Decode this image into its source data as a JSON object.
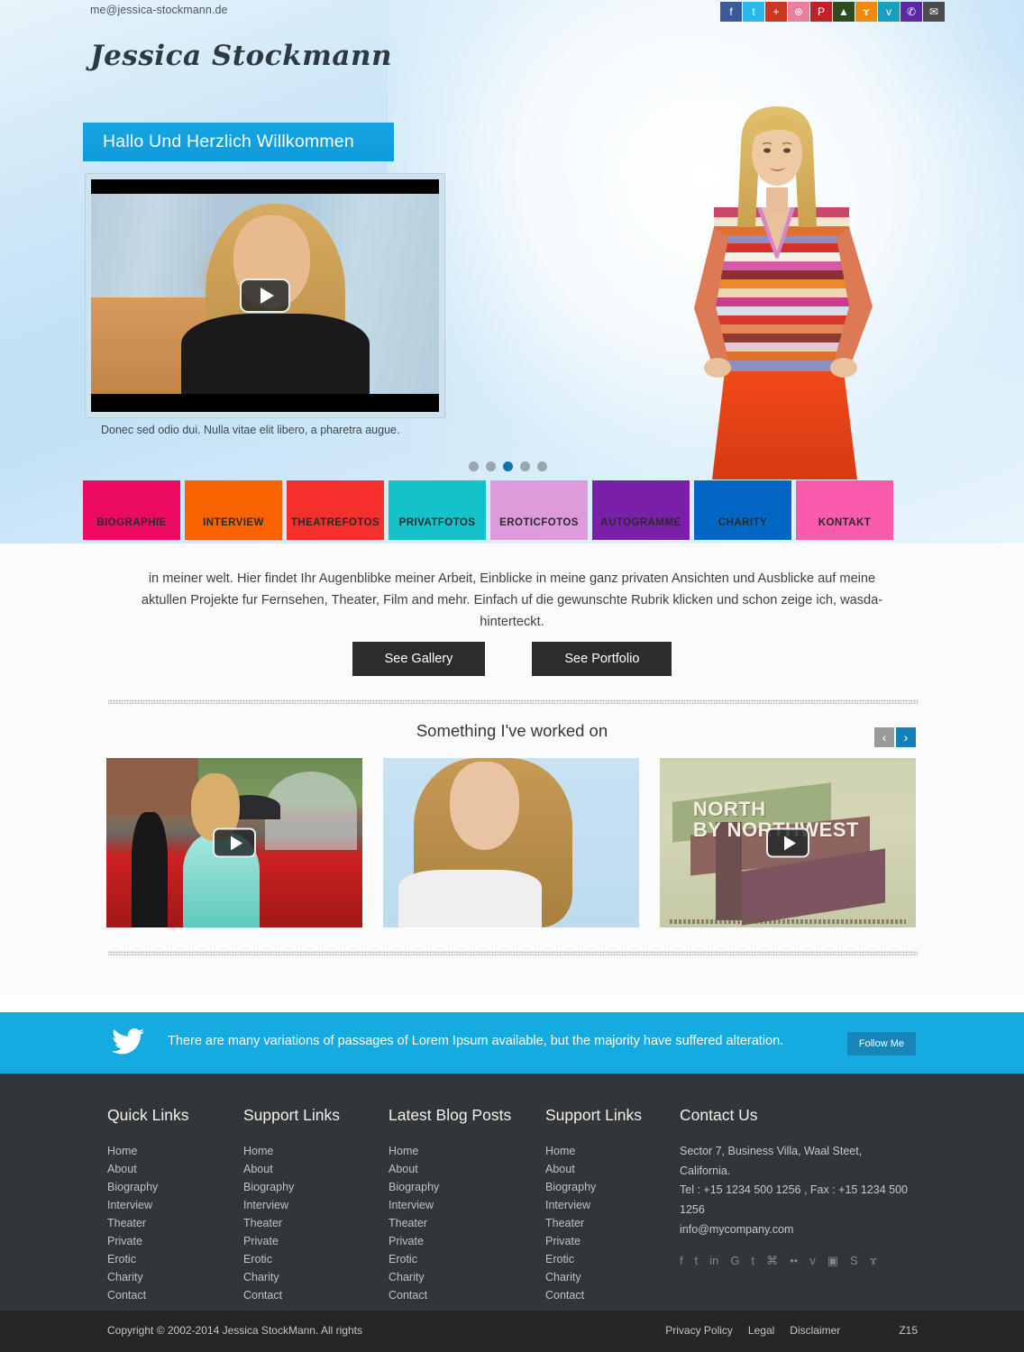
{
  "header": {
    "email": "me@jessica-stockmann.de",
    "brand": "Jessica Stockmann",
    "social": [
      {
        "name": "facebook-icon",
        "glyph": "f",
        "color": "#3B5998"
      },
      {
        "name": "twitter-icon",
        "glyph": "t",
        "color": "#2CB7EC"
      },
      {
        "name": "google-plus-icon",
        "glyph": "+",
        "color": "#C8391F"
      },
      {
        "name": "dribbble-icon",
        "glyph": "⊛",
        "color": "#E8809C"
      },
      {
        "name": "pinterest-icon",
        "glyph": "P",
        "color": "#C4202A"
      },
      {
        "name": "android-icon",
        "glyph": "▲",
        "color": "#2E4A1E"
      },
      {
        "name": "rss-icon",
        "glyph": "ɤ",
        "color": "#F08A0A"
      },
      {
        "name": "vimeo-icon",
        "glyph": "v",
        "color": "#17A0C4"
      },
      {
        "name": "phone-icon",
        "glyph": "✆",
        "color": "#5B28A8"
      },
      {
        "name": "email-icon",
        "glyph": "✉",
        "color": "#4B4B4B"
      }
    ]
  },
  "hero": {
    "banner_title": "Hallo Und Herzlich Willkommen",
    "slide_caption": "Donec sed odio dui. Nulla vitae elit libero, a pharetra augue.",
    "play_label": "▶",
    "dots": [
      {
        "active": false
      },
      {
        "active": false
      },
      {
        "active": true
      },
      {
        "active": false
      },
      {
        "active": false
      }
    ]
  },
  "nav": [
    {
      "label": "BIOGRAPHIE",
      "color": "#ED0A63"
    },
    {
      "label": "INTERVIEW",
      "color": "#F96200"
    },
    {
      "label": "THEATREFOTOS",
      "color": "#F5302C"
    },
    {
      "label": "PRIVATFOTOS",
      "color": "#14C2C9"
    },
    {
      "label": "EROTICFOTOS",
      "color": "#DE9BDB"
    },
    {
      "label": "AUTOGRAMME",
      "color": "#7A1FA8"
    },
    {
      "label": "CHARITY",
      "color": "#0068C4"
    },
    {
      "label": "KONTAKT",
      "color": "#FA5CAB"
    }
  ],
  "intro": {
    "paragraph": "in meiner welt. Hier findet Ihr Augenblibke meiner Arbeit, Einblicke in meine ganz privaten Ansichten und Ausblicke auf meine aktullen Projekte fur Fernsehen, Theater, Film and mehr. Einfach uf die gewunschte Rubrik klicken und schon zeige ich, wasda-hinterteckt.",
    "gallery_button": "See Gallery",
    "portfolio_button": "See Portfolio"
  },
  "portfolio": {
    "title": "Something I've worked on",
    "prev": "‹",
    "next": "›",
    "items": [
      {
        "name": "red-carpet-video",
        "has_play": true,
        "caption3": ""
      },
      {
        "name": "portrait-photo",
        "has_play": false,
        "caption3": ""
      },
      {
        "name": "north-by-northwest-video",
        "has_play": true,
        "caption3": "NORTH\nBY NORTHWEST"
      }
    ]
  },
  "twitter": {
    "message": "There are many variations of passages of Lorem Ipsum available, but the majority have suffered alteration.",
    "follow_label": "Follow Me",
    "bar_color": "#15AAE0"
  },
  "footer": {
    "columns": [
      {
        "title": "Quick Links",
        "links": [
          "Home",
          "About",
          "Biography",
          "Interview",
          "Theater",
          "Private",
          "Erotic",
          "Charity",
          "Contact"
        ]
      },
      {
        "title": "Support Links",
        "links": [
          "Home",
          "About",
          "Biography",
          "Interview",
          "Theater",
          "Private",
          "Erotic",
          "Charity",
          "Contact"
        ]
      },
      {
        "title": "Latest Blog Posts",
        "links": [
          "Home",
          "About",
          "Biography",
          "Interview",
          "Theater",
          "Private",
          "Erotic",
          "Charity",
          "Contact"
        ]
      },
      {
        "title": "Support Links",
        "links": [
          "Home",
          "About",
          "Biography",
          "Interview",
          "Theater",
          "Private",
          "Erotic",
          "Charity",
          "Contact"
        ]
      }
    ],
    "contact": {
      "title": "Contact Us",
      "address": "Sector 7, Business Villa, Waal Steet, California.",
      "phone": "Tel : +15 1234 500 1256 , Fax : +15 1234 500 1256",
      "email": "info@mycompany.com",
      "social": [
        {
          "name": "facebook-icon",
          "glyph": "f"
        },
        {
          "name": "twitter-icon",
          "glyph": "t"
        },
        {
          "name": "linkedin-icon",
          "glyph": "in"
        },
        {
          "name": "google-icon",
          "glyph": "G"
        },
        {
          "name": "tumblr-icon",
          "glyph": "t"
        },
        {
          "name": "apple-icon",
          "glyph": "⌘"
        },
        {
          "name": "flickr-icon",
          "glyph": "••"
        },
        {
          "name": "vimeo-icon",
          "glyph": "v"
        },
        {
          "name": "youtube-icon",
          "glyph": "▣"
        },
        {
          "name": "skype-icon",
          "glyph": "S"
        },
        {
          "name": "rss-icon",
          "glyph": "ɤ"
        }
      ]
    }
  },
  "bottom": {
    "copyright": "Copyright © 2002-2014  Jessica StockMann. All rights",
    "links": [
      "Privacy Policy",
      "Legal",
      "Disclaimer"
    ],
    "mark": "Z15"
  }
}
